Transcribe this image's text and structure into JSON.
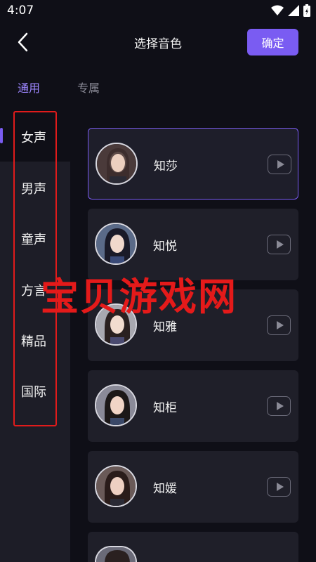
{
  "status_bar": {
    "time": "4:07",
    "icons": [
      "wifi-icon",
      "signal-icon",
      "battery-charging-icon"
    ]
  },
  "header": {
    "title": "选择音色",
    "confirm_label": "确定"
  },
  "tabs": [
    {
      "label": "通用",
      "active": true
    },
    {
      "label": "专属",
      "active": false
    }
  ],
  "sidebar": {
    "items": [
      "女声",
      "男声",
      "童声",
      "方言",
      "精品",
      "国际"
    ],
    "selected_index": 0
  },
  "voices": [
    {
      "name": "知莎",
      "selected": true
    },
    {
      "name": "知悦",
      "selected": false
    },
    {
      "name": "知雅",
      "selected": false
    },
    {
      "name": "知柜",
      "selected": false
    },
    {
      "name": "知媛",
      "selected": false
    }
  ],
  "watermark": "宝贝游戏网",
  "colors": {
    "accent": "#7a5cf2",
    "background": "#0f0f17",
    "card": "#1f1f29",
    "highlight_box": "#e01b1b"
  }
}
